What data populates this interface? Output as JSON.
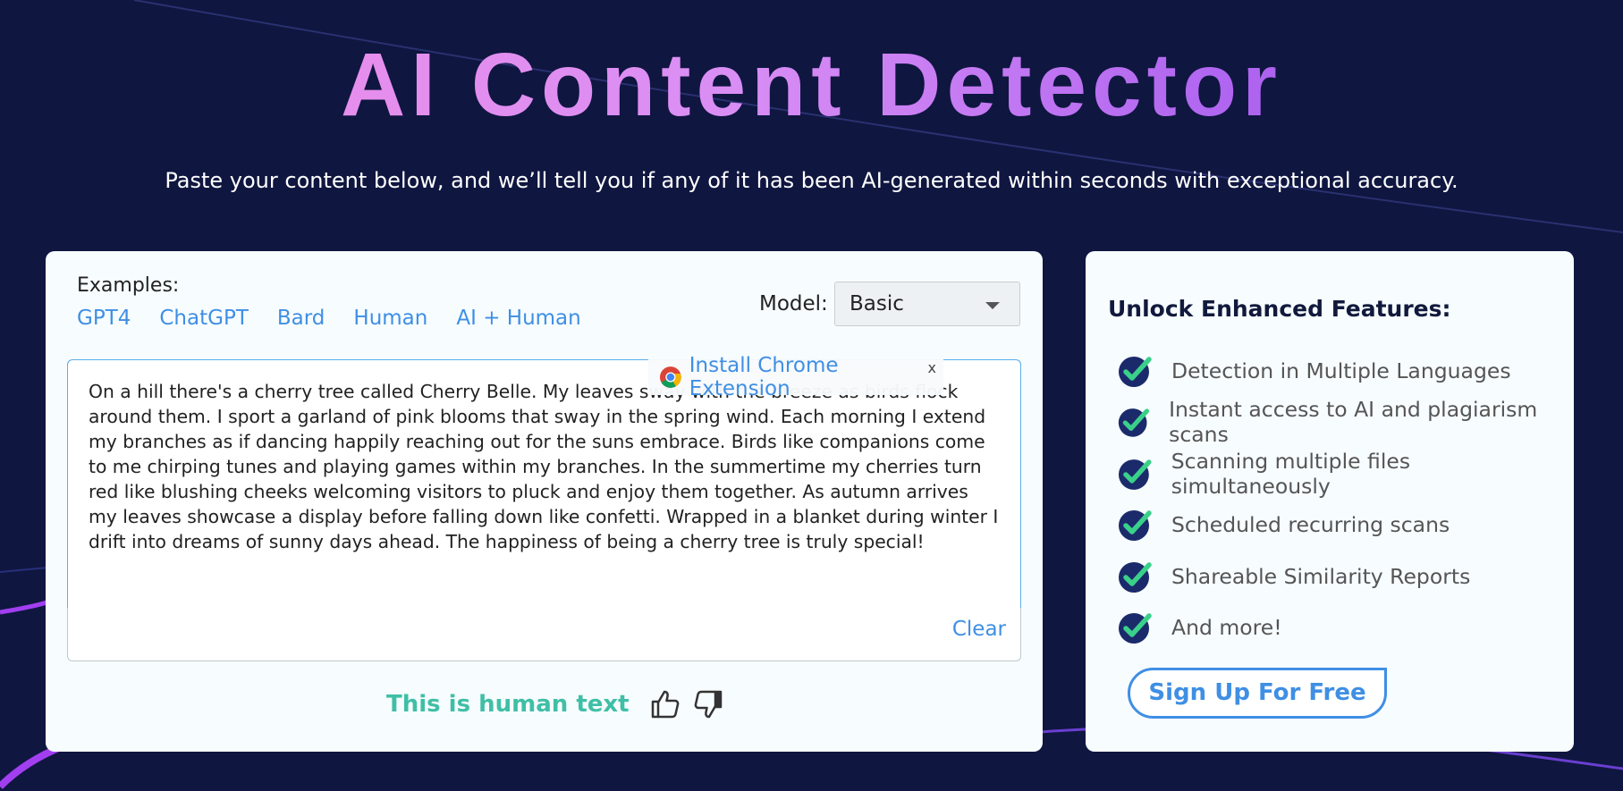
{
  "header": {
    "title": "AI Content Detector",
    "subtitle": "Paste your content below, and we’ll tell you if any of it has been AI-generated within seconds with exceptional accuracy."
  },
  "detector": {
    "examples_label": "Examples:",
    "examples": [
      "GPT4",
      "ChatGPT",
      "Bard",
      "Human",
      "AI + Human"
    ],
    "model_label": "Model:",
    "model_value": "Basic",
    "text": "On a hill there's a cherry tree called Cherry Belle. My leaves sway with the breeze as birds flock around them. I sport a garland of pink blooms that sway in the spring wind. Each morning I extend my branches as if dancing happily reaching out for the suns embrace. Birds like companions come to me chirping tunes and playing games within my branches. In the summertime my cherries turn red like blushing cheeks welcoming visitors to pluck and enjoy them together. As autumn arrives my leaves showcase a display before falling down like confetti. Wrapped in a blanket during winter I drift into dreams of sunny days ahead. The happiness of being a cherry tree is truly special!",
    "clear_label": "Clear",
    "extension_banner": "Install Chrome Extension",
    "extension_close": "x",
    "result_text": "This is human text"
  },
  "features": {
    "title": "Unlock Enhanced Features:",
    "items": [
      "Detection in Multiple Languages",
      "Instant access to AI and plagiarism scans",
      "Scanning multiple files simultaneously",
      "Scheduled recurring scans",
      "Shareable Similarity Reports",
      "And more!"
    ],
    "signup_label": "Sign Up For Free"
  },
  "colors": {
    "background": "#0f1640",
    "accent": "#3f8fe4",
    "result_green": "#3fbfa6",
    "check_green": "#3ad08a",
    "check_navy": "#1b2a6b"
  },
  "icons": [
    "chrome-icon",
    "thumbs-up-icon",
    "thumbs-down-icon",
    "check-icon",
    "caret-down-icon"
  ]
}
